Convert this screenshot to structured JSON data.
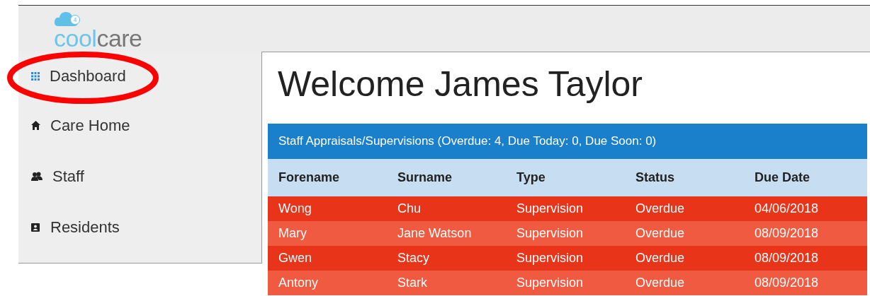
{
  "logo": {
    "badge": "4",
    "words": [
      "cool",
      "care"
    ]
  },
  "sidebar": {
    "items": [
      {
        "label": "Dashboard",
        "kind": "grid",
        "highlighted": true
      },
      {
        "label": "Care Home",
        "kind": "home",
        "highlighted": false
      },
      {
        "label": "Staff",
        "kind": "people",
        "highlighted": false
      },
      {
        "label": "Residents",
        "kind": "card",
        "highlighted": false
      }
    ]
  },
  "heading": "Welcome James Taylor",
  "table": {
    "title": "Staff Appraisals/Supervisions (Overdue: 4, Due Today: 0, Due Soon: 0)",
    "columns": [
      "Forename",
      "Surname",
      "Type",
      "Status",
      "Due Date"
    ],
    "rows": [
      [
        "Wong",
        "Chu",
        "Supervision",
        "Overdue",
        "04/06/2018"
      ],
      [
        "Mary",
        "Jane Watson",
        "Supervision",
        "Overdue",
        "08/09/2018"
      ],
      [
        "Gwen",
        "Stacy",
        "Supervision",
        "Overdue",
        "08/09/2018"
      ],
      [
        "Antony",
        "Stark",
        "Supervision",
        "Overdue",
        "08/09/2018"
      ]
    ]
  }
}
